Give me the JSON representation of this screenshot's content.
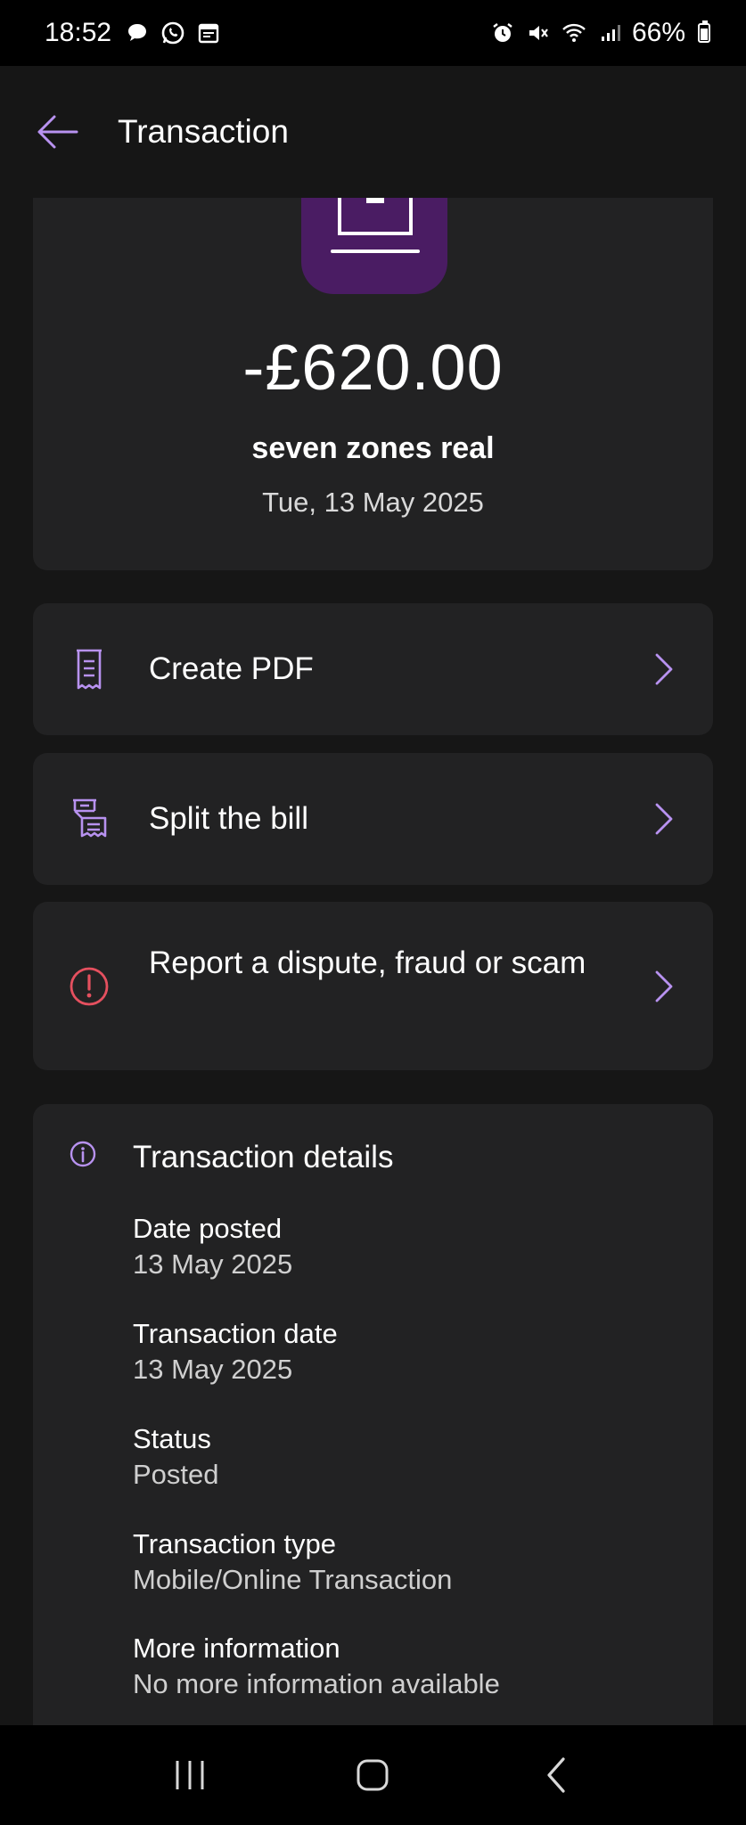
{
  "status_bar": {
    "time": "18:52",
    "battery": "66%",
    "icons": [
      "chat-icon",
      "whatsapp-icon",
      "calendar-icon",
      "alarm-icon",
      "mute-icon",
      "wifi-icon",
      "signal-icon",
      "battery-icon"
    ]
  },
  "header": {
    "title": "Transaction",
    "back_icon": "arrow-left-icon"
  },
  "transaction": {
    "amount": "-£620.00",
    "merchant": "seven zones real",
    "date": "Tue, 13 May 2025",
    "icon": "laptop-icon"
  },
  "actions": [
    {
      "label": "Create PDF",
      "icon": "receipt-icon"
    },
    {
      "label": "Split the bill",
      "icon": "split-receipt-icon"
    },
    {
      "label": "Report a dispute, fraud or scam",
      "icon": "alert-circle-icon"
    }
  ],
  "details": {
    "title": "Transaction details",
    "items": [
      {
        "label": "Date posted",
        "value": "13 May 2025"
      },
      {
        "label": "Transaction date",
        "value": "13 May 2025"
      },
      {
        "label": "Status",
        "value": "Posted"
      },
      {
        "label": "Transaction type",
        "value": "Mobile/Online Transaction"
      },
      {
        "label": "More information",
        "value": "No more information available"
      }
    ]
  },
  "colors": {
    "accent": "#b892f0",
    "alert": "#e5505f",
    "card": "#222223",
    "background": "#161616",
    "icon_tile": "#4a1c63"
  }
}
